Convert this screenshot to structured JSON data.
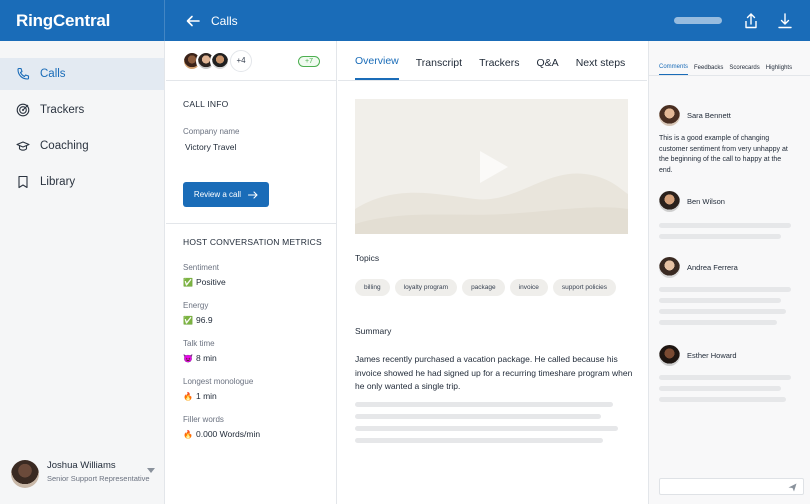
{
  "app": {
    "brand": "RingCentral"
  },
  "header": {
    "title": "Calls"
  },
  "sidebar": {
    "items": [
      {
        "label": "Calls",
        "icon": "phone-icon"
      },
      {
        "label": "Trackers",
        "icon": "target-icon"
      },
      {
        "label": "Coaching",
        "icon": "graduation-cap-icon"
      },
      {
        "label": "Library",
        "icon": "bookmark-icon"
      }
    ],
    "user": {
      "name": "Joshua Williams",
      "role": "Senior Support Representative"
    }
  },
  "call_info": {
    "participants_more": "+4",
    "participants_badge": "+7",
    "heading": "CALL INFO",
    "company_label": "Company name",
    "company_value": "Victory Travel",
    "review_button": "Review a call",
    "metrics_heading": "HOST CONVERSATION METRICS",
    "metrics": [
      {
        "label": "Sentiment",
        "emoji": "✅",
        "value": "Positive"
      },
      {
        "label": "Energy",
        "emoji": "✅",
        "value": "96.9"
      },
      {
        "label": "Talk time",
        "emoji": "😈",
        "value": "8 min"
      },
      {
        "label": "Longest monologue",
        "emoji": "🔥",
        "value": "1 min"
      },
      {
        "label": "Filler words",
        "emoji": "🔥",
        "value": "0.000 Words/min"
      }
    ]
  },
  "main": {
    "tabs": [
      "Overview",
      "Transcript",
      "Trackers",
      "Q&A",
      "Next steps"
    ],
    "topics_label": "Topics",
    "topics": [
      "billing",
      "loyalty program",
      "package",
      "invoice",
      "support policies"
    ],
    "summary_label": "Summary",
    "summary_text": "James recently purchased a vacation package. He called because his invoice showed he had signed up for a recurring timeshare program when he only wanted a single trip."
  },
  "comments_panel": {
    "tabs": [
      "Comments",
      "Feedbacks",
      "Scorecards",
      "Highlights"
    ],
    "comments": [
      {
        "name": "Sara Bennett",
        "text": "This is a good example of changing customer sentiment from very unhappy at the beginning of the call to happy at the end."
      },
      {
        "name": "Ben Wilson"
      },
      {
        "name": "Andrea Ferrera"
      },
      {
        "name": "Esther Howard"
      }
    ]
  },
  "colors": {
    "brand_blue": "#1a6cb8",
    "active_nav_bg": "#e3eaf2",
    "positive_green": "#4caf50"
  }
}
